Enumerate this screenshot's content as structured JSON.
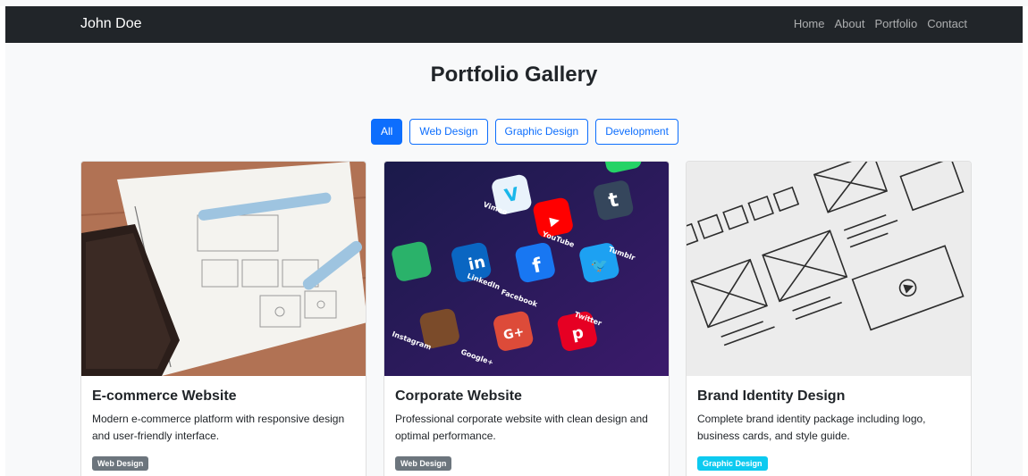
{
  "navbar": {
    "brand": "John Doe",
    "links": [
      "Home",
      "About",
      "Portfolio",
      "Contact"
    ]
  },
  "page": {
    "title": "Portfolio Gallery"
  },
  "filters": {
    "active": "All",
    "buttons": [
      "All",
      "Web Design",
      "Graphic Design",
      "Development"
    ]
  },
  "colors": {
    "navbar_bg": "#212529",
    "primary": "#0d6efd",
    "badge_web": "#6c757d",
    "badge_graphic": "#0dcaf0"
  },
  "cards": [
    {
      "title": "E-commerce Website",
      "description": "Modern e-commerce platform with responsive design and user-friendly interface.",
      "badge": "Web Design"
    },
    {
      "title": "Corporate Website",
      "description": "Professional corporate website with clean design and optimal performance.",
      "badge": "Web Design",
      "apps": [
        "Vimeo",
        "YouTube",
        "Tumblr",
        "LinkedIn",
        "Facebook",
        "Twitter",
        "Instagram",
        "Google+"
      ]
    },
    {
      "title": "Brand Identity Design",
      "description": "Complete brand identity package including logo, business cards, and style guide.",
      "badge": "Graphic Design"
    }
  ]
}
